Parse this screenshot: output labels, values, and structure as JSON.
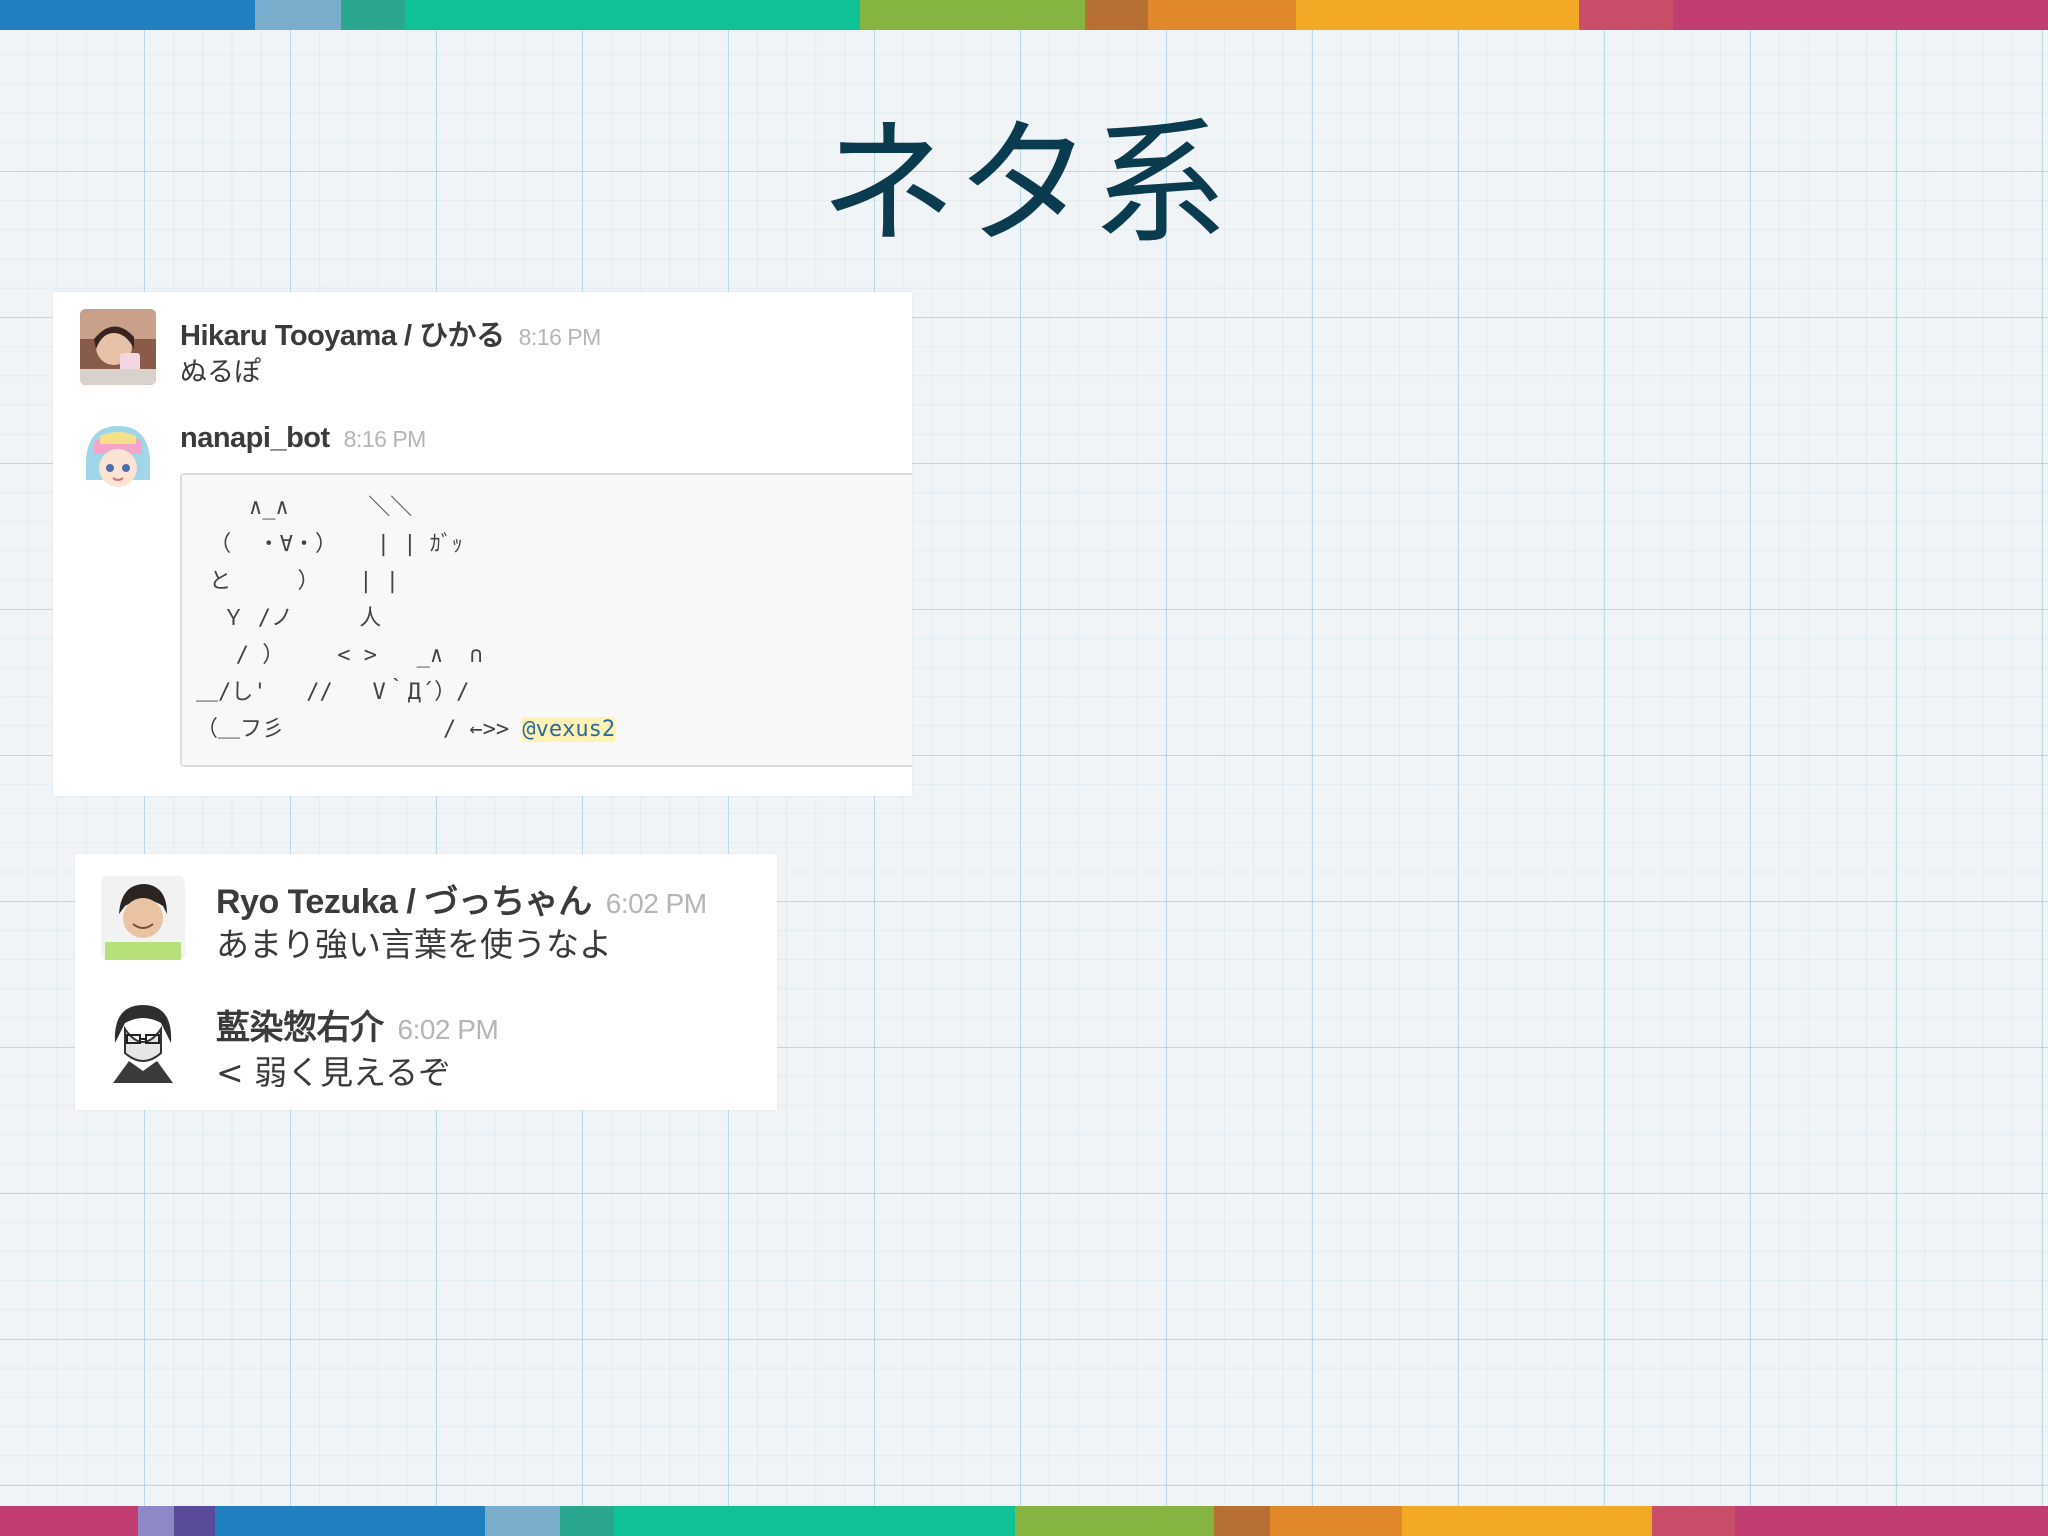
{
  "slide": {
    "title": "ネタ系"
  },
  "stripe_colors": [
    "#1f7fbf",
    "#7aaccc",
    "#2aa78e",
    "#10c196",
    "#86b440",
    "#c9783a",
    "#e0882a",
    "#f2a925",
    "#c84e6a",
    "#c13c70"
  ],
  "top_chat": {
    "messages": [
      {
        "author": "Hikaru Tooyama / ひかる",
        "time": "8:16 PM",
        "text": "ぬるぽ"
      },
      {
        "author": "nanapi_bot",
        "time": "8:16 PM"
      }
    ],
    "ascii_art": "    ∧_∧      ＼＼\n （  ・∀・）   | | ｶﾞｯ\n と     ）   | |\n  Ｙ /ノ     人\n   / ）    < >   _∧  ∩\n＿/し'   //   V｀Д´）/\n（＿フ彡            / ←>> ",
    "mention": "@vexus2"
  },
  "bottom_chat": {
    "messages": [
      {
        "author": "Ryo Tezuka / づっちゃん",
        "time": "6:02 PM",
        "text": "あまり強い言葉を使うなよ"
      },
      {
        "author": "藍染惣右介",
        "time": "6:02 PM",
        "text": "< 弱く見えるぞ"
      }
    ]
  }
}
